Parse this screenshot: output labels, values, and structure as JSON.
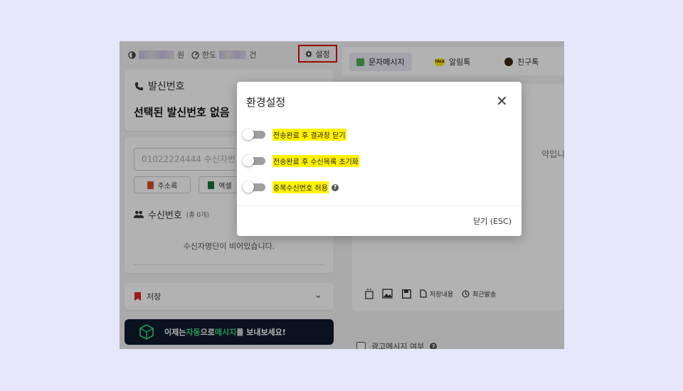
{
  "topbar": {
    "points_unit": "원",
    "limit_label": "한도",
    "limit_unit": "건",
    "settings_label": "설정"
  },
  "sender": {
    "label": "발신번호",
    "value": "선택된 발신번호 없음"
  },
  "receiver": {
    "input_placeholder": "01022224444 수신자번",
    "address_book_label": "주소록",
    "excel_label": "엑셀",
    "title": "수신번호",
    "count_text": "(총 0개)",
    "empty_text": "수신자명단이 비어있습니다."
  },
  "save": {
    "label": "저장"
  },
  "banner": {
    "pre": "이제는 ",
    "hl1": "자동",
    "mid": "으로 ",
    "hl2": "메시지",
    "post": "를 보내보세요!"
  },
  "tabs": [
    {
      "label": "문자메시지",
      "active": true
    },
    {
      "label": "알림톡",
      "active": false
    },
    {
      "label": "친구톡",
      "active": false
    }
  ],
  "message": {
    "placeholder_tail": "약입니다.",
    "tools": {
      "saved_label": "저장내용",
      "recent_label": "최근발송"
    }
  },
  "ad": {
    "label": "광고메시지 여부"
  },
  "modal": {
    "title": "환경설정",
    "options": [
      {
        "label": "전송완료 후 결과창 닫기",
        "enabled": false,
        "help": false
      },
      {
        "label": "전송완료 후 수신목록 초기화",
        "enabled": false,
        "help": false
      },
      {
        "label": "중복수신번호 허용",
        "enabled": false,
        "help": true
      }
    ],
    "close_label": "닫기 (ESC)"
  },
  "colors": {
    "highlight": "#fff200",
    "focus_border": "#e01010",
    "banner_bg": "#0f1a2e",
    "banner_accent": "#37d67a"
  }
}
